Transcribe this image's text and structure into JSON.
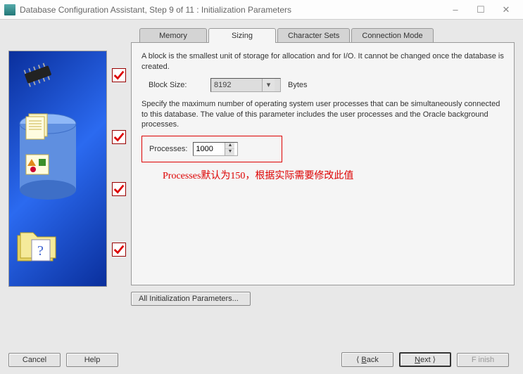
{
  "window": {
    "title": "Database Configuration Assistant, Step 9 of 11 : Initialization Parameters"
  },
  "tabs": {
    "memory": "Memory",
    "sizing": "Sizing",
    "charsets": "Character Sets",
    "connmode": "Connection Mode"
  },
  "sizing": {
    "block_desc": "A block is the smallest unit of storage for allocation and for I/O. It cannot be changed once the database is created.",
    "block_label": "Block Size:",
    "block_value": "8192",
    "block_unit": "Bytes",
    "proc_desc": "Specify the maximum number of operating system user processes that can be simultaneously connected to this database. The value of this parameter includes the user processes and the Oracle background processes.",
    "proc_label": "Processes:",
    "proc_value": "1000"
  },
  "annotation": "Processes默认为150，根据实际需要修改此值",
  "buttons": {
    "all_params": "All Initialization Parameters...",
    "cancel": "Cancel",
    "help": "Help",
    "back": "Back",
    "next": "Next",
    "finish": "Finish"
  }
}
